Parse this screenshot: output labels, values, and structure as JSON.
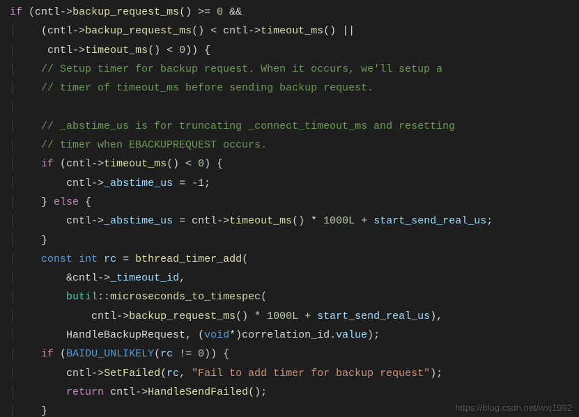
{
  "code": {
    "l1": {
      "if": "if",
      "p1": " (",
      "id1": "cntl",
      "arrow1": "->",
      "fn1": "backup_request_ms",
      "p2": "() >= ",
      "num1": "0",
      "p3": " &&"
    },
    "l2": {
      "pad": "    (",
      "id1": "cntl",
      "arrow1": "->",
      "fn1": "backup_request_ms",
      "p1": "() < ",
      "id2": "cntl",
      "arrow2": "->",
      "fn2": "timeout_ms",
      "p2": "() ||"
    },
    "l3": {
      "pad": "     ",
      "id1": "cntl",
      "arrow": "->",
      "fn": "timeout_ms",
      "p": "() < ",
      "num": "0",
      "end": ")) {"
    },
    "l4": {
      "c": "    // Setup timer for backup request. When it occurs, we'll setup a"
    },
    "l5": {
      "c": "    // timer of timeout_ms before sending backup request."
    },
    "l6": {
      "blank": ""
    },
    "l7": {
      "c": "    // _abstime_us is for truncating _connect_timeout_ms and resetting"
    },
    "l8": {
      "c": "    // timer when EBACKUPREQUEST occurs."
    },
    "l9": {
      "pad": "    ",
      "if": "if",
      "p1": " (",
      "id": "cntl",
      "arrow": "->",
      "fn": "timeout_ms",
      "p2": "() < ",
      "num": "0",
      "p3": ") {"
    },
    "l10": {
      "pad": "        ",
      "id": "cntl",
      "arrow": "->",
      "var": "_abstime_us",
      "p1": " = ",
      "num": "-1",
      "p2": ";"
    },
    "l11": {
      "pad": "    } ",
      "else": "else",
      "p": " {"
    },
    "l12": {
      "pad": "        ",
      "id1": "cntl",
      "arrow1": "->",
      "var": "_abstime_us",
      "p1": " = ",
      "id2": "cntl",
      "arrow2": "->",
      "fn": "timeout_ms",
      "p2": "() * ",
      "num": "1000L",
      "p3": " + ",
      "v2": "start_send_real_us",
      "p4": ";"
    },
    "l13": {
      "pad": "    }"
    },
    "l14": {
      "pad": "    ",
      "kw1": "const",
      "sp": " ",
      "kw2": "int",
      "p1": " ",
      "var": "rc",
      "p2": " = ",
      "fn": "bthread_timer_add",
      "p3": "("
    },
    "l15": {
      "pad": "        &",
      "id": "cntl",
      "arrow": "->",
      "var": "_timeout_id",
      "p": ","
    },
    "l16": {
      "pad": "        ",
      "ns": "butil",
      "colons": "::",
      "fn": "microseconds_to_timespec",
      "p": "("
    },
    "l17": {
      "pad": "            ",
      "id": "cntl",
      "arrow": "->",
      "fn": "backup_request_ms",
      "p1": "() * ",
      "num": "1000L",
      "p2": " + ",
      "var": "start_send_real_us",
      "p3": "),"
    },
    "l18": {
      "pad": "        ",
      "id1": "HandleBackupRequest",
      "p1": ", (",
      "kw": "void",
      "p2": "*)",
      "id2": "correlation_id",
      "dot": ".",
      "var": "value",
      "p3": ");"
    },
    "l19": {
      "pad": "    ",
      "if": "if",
      "p1": " (",
      "macro": "BAIDU_UNLIKELY",
      "p2": "(",
      "var": "rc",
      "p3": " != ",
      "num": "0",
      "p4": ")) {"
    },
    "l20": {
      "pad": "        ",
      "id": "cntl",
      "arrow": "->",
      "fn": "SetFailed",
      "p1": "(",
      "var": "rc",
      "p2": ", ",
      "str": "\"Fail to add timer for backup request\"",
      "p3": ");"
    },
    "l21": {
      "pad": "        ",
      "ret": "return",
      "p1": " ",
      "id": "cntl",
      "arrow": "->",
      "fn": "HandleSendFailed",
      "p2": "();"
    },
    "l22": {
      "pad": "    }"
    }
  },
  "watermark": "https://blog.csdn.net/wxj1992"
}
